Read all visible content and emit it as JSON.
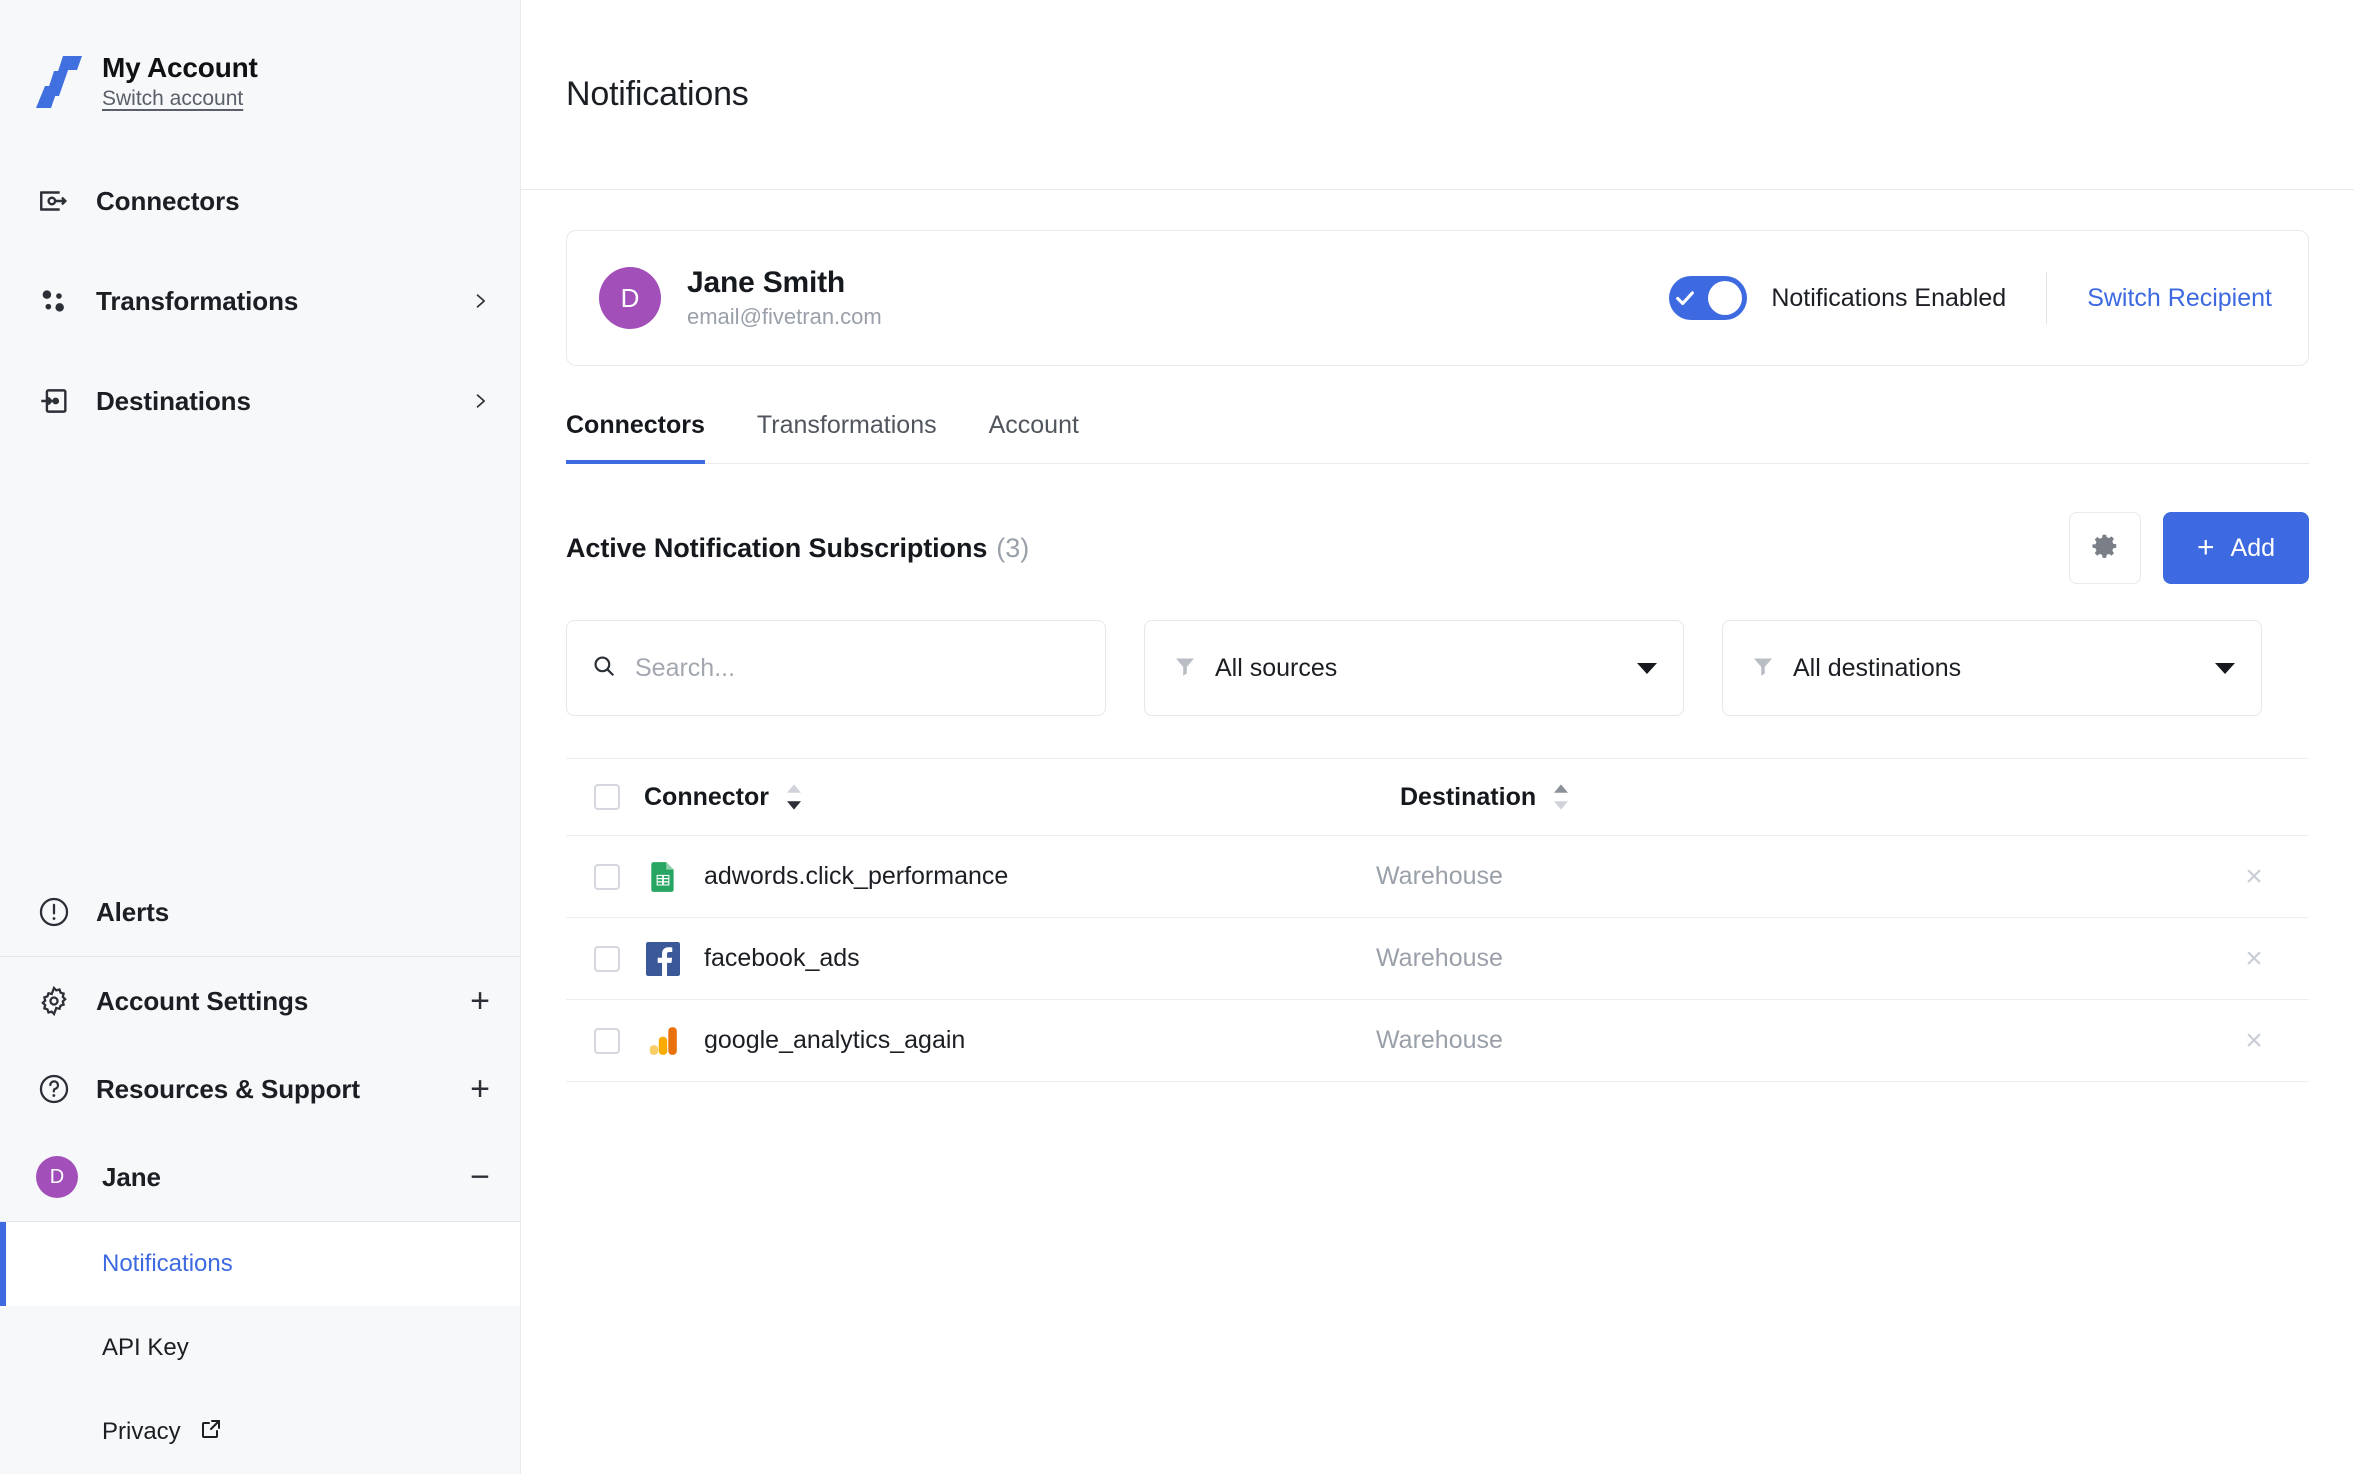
{
  "sidebar": {
    "brand": {
      "title": "My Account",
      "switch": "Switch account"
    },
    "main_nav": [
      {
        "label": "Connectors",
        "icon": "connectors-icon",
        "expandable": false
      },
      {
        "label": "Transformations",
        "icon": "transformations-icon",
        "expandable": true
      },
      {
        "label": "Destinations",
        "icon": "destinations-icon",
        "expandable": true
      }
    ],
    "bottom_nav": [
      {
        "label": "Alerts",
        "icon": "alert-icon",
        "affordance": ""
      },
      {
        "label": "Account Settings",
        "icon": "gear-icon",
        "affordance": "+"
      },
      {
        "label": "Resources & Support",
        "icon": "question-icon",
        "affordance": "+"
      },
      {
        "label": "Jane",
        "icon": "avatar",
        "affordance": "−",
        "initial": "D"
      }
    ],
    "subnav": [
      {
        "label": "Notifications",
        "active": true,
        "external": false
      },
      {
        "label": "API Key",
        "active": false,
        "external": false
      },
      {
        "label": "Privacy",
        "active": false,
        "external": true
      }
    ]
  },
  "header": {
    "title": "Notifications"
  },
  "recipient": {
    "initial": "D",
    "name": "Jane Smith",
    "email": "email@fivetran.com",
    "toggle_on": true,
    "toggle_label": "Notifications Enabled",
    "switch_link": "Switch Recipient"
  },
  "tabs": [
    {
      "label": "Connectors",
      "active": true
    },
    {
      "label": "Transformations",
      "active": false
    },
    {
      "label": "Account",
      "active": false
    }
  ],
  "section": {
    "title": "Active Notification Subscriptions",
    "count": "(3)",
    "gear_icon": "gear-icon",
    "add_label": "Add",
    "add_plus": "+"
  },
  "filters": {
    "search_placeholder": "Search...",
    "search_value": "",
    "sources_label": "All sources",
    "destinations_label": "All destinations"
  },
  "table": {
    "columns": [
      {
        "label": "Connector",
        "sort": "desc"
      },
      {
        "label": "Destination",
        "sort": "asc"
      }
    ],
    "rows": [
      {
        "connector": "adwords.click_performance",
        "destination": "Warehouse",
        "icon": "google-sheets-icon",
        "checked": false,
        "remove": "×"
      },
      {
        "connector": "facebook_ads",
        "destination": "Warehouse",
        "icon": "facebook-icon",
        "checked": false,
        "remove": "×"
      },
      {
        "connector": "google_analytics_again",
        "destination": "Warehouse",
        "icon": "google-analytics-icon",
        "checked": false,
        "remove": "×"
      }
    ]
  },
  "colors": {
    "accent_blue": "#3d6ae0",
    "avatar_purple": "#a34fba",
    "sidebar_bg": "#f7f8fa",
    "muted_text": "#9aa0a9",
    "sheets_green": "#27a563",
    "facebook_blue": "#3b5998",
    "analytics_orange": "#e8710a",
    "analytics_yellow": "#f9ab00"
  }
}
